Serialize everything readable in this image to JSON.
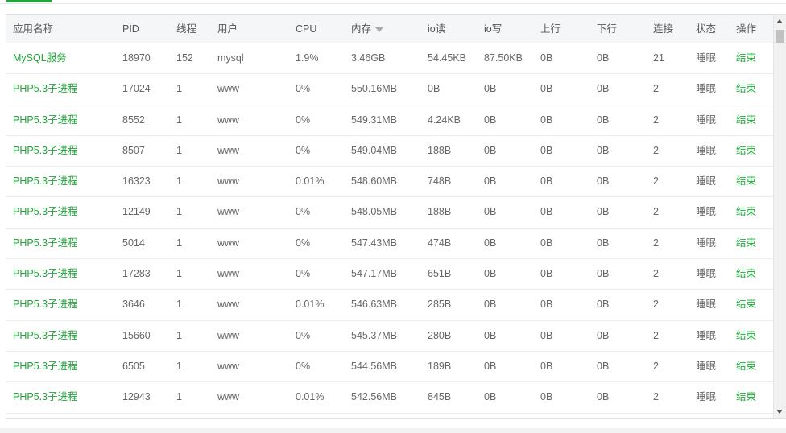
{
  "columns": [
    "应用名称",
    "PID",
    "线程",
    "用户",
    "CPU",
    "内存",
    "io读",
    "io写",
    "上行",
    "下行",
    "连接",
    "状态",
    "操作"
  ],
  "rows": [
    [
      "MySQL服务",
      "18970",
      "152",
      "mysql",
      "1.9%",
      "3.46GB",
      "54.45KB",
      "87.50KB",
      "0B",
      "0B",
      "21",
      "睡眠",
      "结束"
    ],
    [
      "PHP5.3子进程",
      "17024",
      "1",
      "www",
      "0%",
      "550.16MB",
      "0B",
      "0B",
      "0B",
      "0B",
      "2",
      "睡眠",
      "结束"
    ],
    [
      "PHP5.3子进程",
      "8552",
      "1",
      "www",
      "0%",
      "549.31MB",
      "4.24KB",
      "0B",
      "0B",
      "0B",
      "2",
      "睡眠",
      "结束"
    ],
    [
      "PHP5.3子进程",
      "8507",
      "1",
      "www",
      "0%",
      "549.04MB",
      "188B",
      "0B",
      "0B",
      "0B",
      "2",
      "睡眠",
      "结束"
    ],
    [
      "PHP5.3子进程",
      "16323",
      "1",
      "www",
      "0.01%",
      "548.60MB",
      "748B",
      "0B",
      "0B",
      "0B",
      "2",
      "睡眠",
      "结束"
    ],
    [
      "PHP5.3子进程",
      "12149",
      "1",
      "www",
      "0%",
      "548.05MB",
      "188B",
      "0B",
      "0B",
      "0B",
      "2",
      "睡眠",
      "结束"
    ],
    [
      "PHP5.3子进程",
      "5014",
      "1",
      "www",
      "0%",
      "547.43MB",
      "474B",
      "0B",
      "0B",
      "0B",
      "2",
      "睡眠",
      "结束"
    ],
    [
      "PHP5.3子进程",
      "17283",
      "1",
      "www",
      "0%",
      "547.17MB",
      "651B",
      "0B",
      "0B",
      "0B",
      "2",
      "睡眠",
      "结束"
    ],
    [
      "PHP5.3子进程",
      "3646",
      "1",
      "www",
      "0.01%",
      "546.63MB",
      "285B",
      "0B",
      "0B",
      "0B",
      "2",
      "睡眠",
      "结束"
    ],
    [
      "PHP5.3子进程",
      "15660",
      "1",
      "www",
      "0%",
      "545.37MB",
      "280B",
      "0B",
      "0B",
      "0B",
      "2",
      "睡眠",
      "结束"
    ],
    [
      "PHP5.3子进程",
      "6505",
      "1",
      "www",
      "0%",
      "544.56MB",
      "189B",
      "0B",
      "0B",
      "0B",
      "2",
      "睡眠",
      "结束"
    ],
    [
      "PHP5.3子进程",
      "12943",
      "1",
      "www",
      "0.01%",
      "542.56MB",
      "845B",
      "0B",
      "0B",
      "0B",
      "2",
      "睡眠",
      "结束"
    ]
  ],
  "sorted_column": "内存",
  "icons": {
    "sort": "sort-desc-icon",
    "scroll_up": "scroll-up-icon",
    "scroll_down": "scroll-down-icon"
  },
  "colors": {
    "accent": "#20a53a",
    "header_bg": "#f5f6f7"
  }
}
